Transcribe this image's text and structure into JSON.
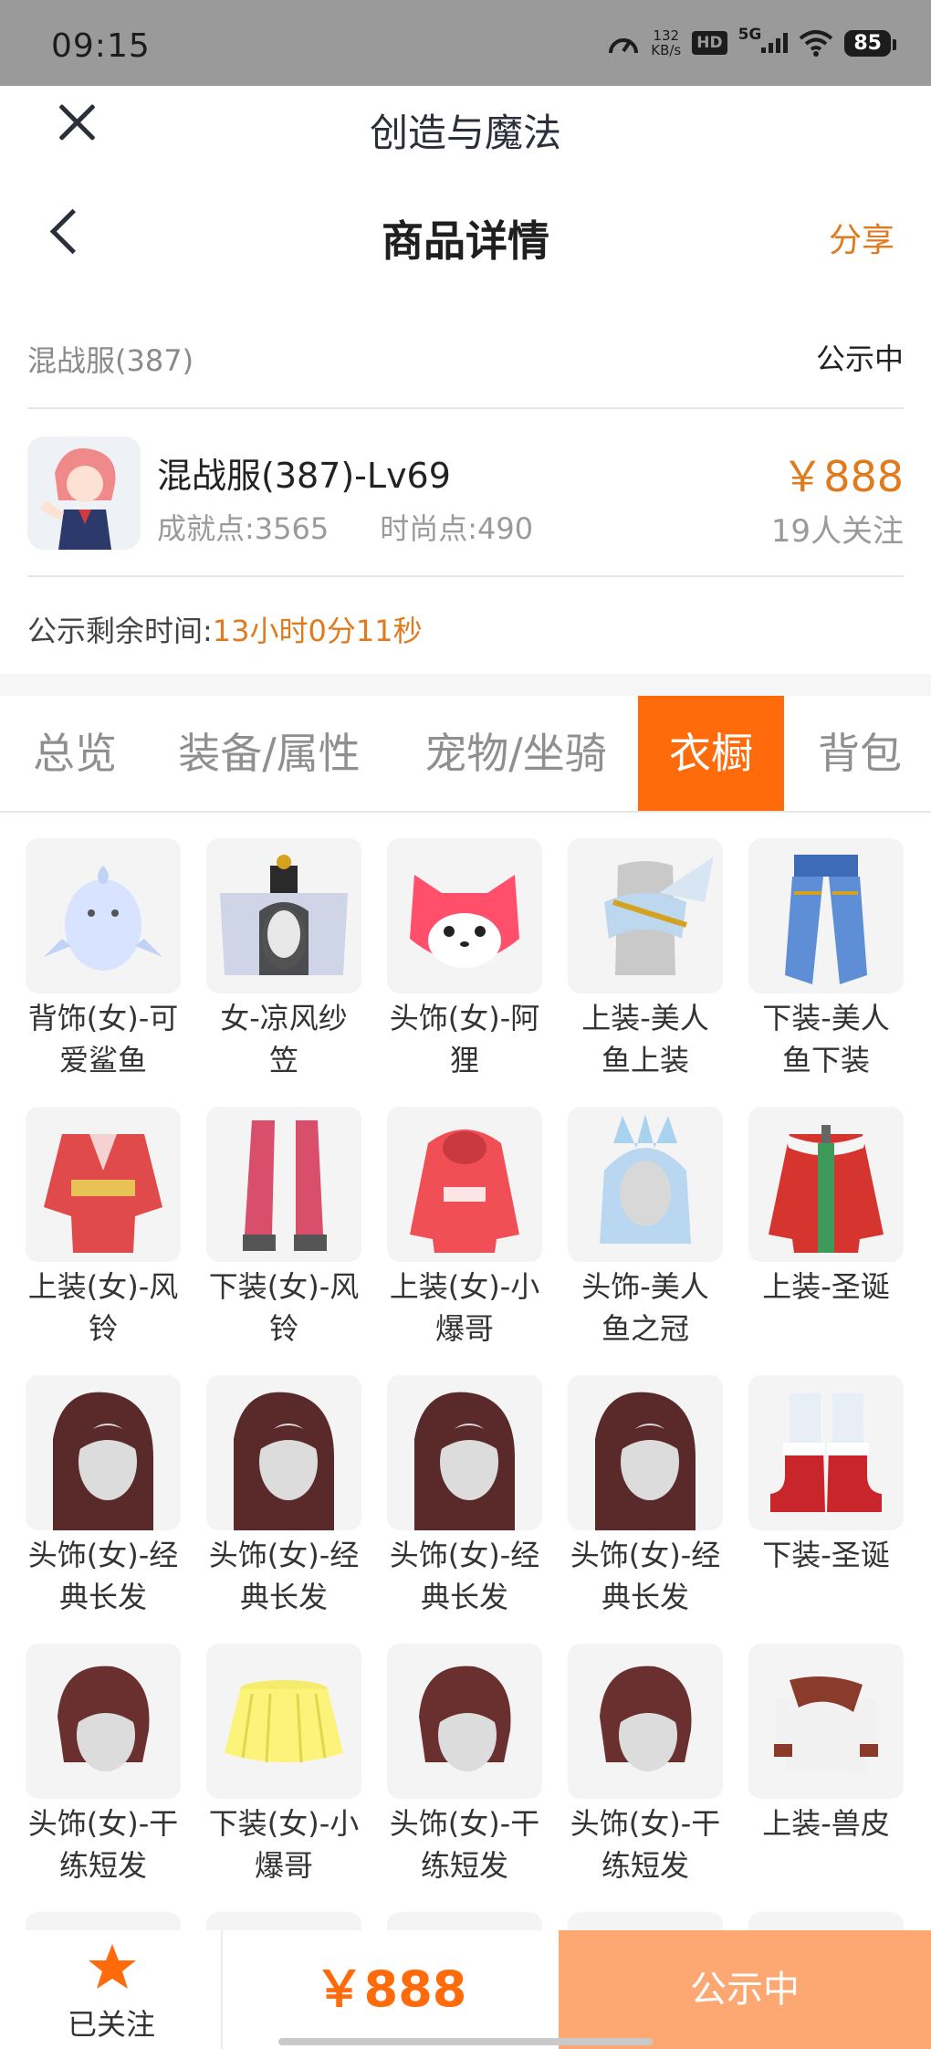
{
  "status_bar": {
    "time": "09:15",
    "speed": "132",
    "speed_unit": "KB/s",
    "hd": "HD",
    "network": "5G",
    "battery": "85"
  },
  "app": {
    "title": "创造与魔法"
  },
  "header": {
    "title": "商品详情",
    "share": "分享"
  },
  "server": {
    "name": "混战服(387)",
    "status": "公示中"
  },
  "item": {
    "title": "混战服(387)-Lv69",
    "achievement": "成就点:3565",
    "fashion": "时尚点:490",
    "price": "￥888",
    "followers": "19人关注"
  },
  "countdown": {
    "label": "公示剩余时间:",
    "value": "13小时0分11秒"
  },
  "tabs": [
    {
      "label": "总览"
    },
    {
      "label": "装备/属性"
    },
    {
      "label": "宠物/坐骑"
    },
    {
      "label": "衣橱",
      "active": true
    },
    {
      "label": "背包"
    }
  ],
  "wardrobe": [
    {
      "label": "背饰(女)-可爱鲨鱼",
      "icon": "shark-backpack-icon"
    },
    {
      "label": "女-凉风纱笠",
      "icon": "veil-hat-icon"
    },
    {
      "label": "头饰(女)-阿狸",
      "icon": "fox-head-icon"
    },
    {
      "label": "上装-美人鱼上装",
      "icon": "mermaid-top-icon"
    },
    {
      "label": "下装-美人鱼下装",
      "icon": "mermaid-bottom-icon"
    },
    {
      "label": "上装(女)-风铃",
      "icon": "kimono-top-icon"
    },
    {
      "label": "下装(女)-风铃",
      "icon": "boots-icon"
    },
    {
      "label": "上装(女)-小爆哥",
      "icon": "hoodie-icon"
    },
    {
      "label": "头饰-美人鱼之冠",
      "icon": "crown-hair-icon"
    },
    {
      "label": "上装-圣诞",
      "icon": "christmas-coat-icon"
    },
    {
      "label": "头饰(女)-经典长发",
      "icon": "long-hair-icon"
    },
    {
      "label": "头饰(女)-经典长发",
      "icon": "long-hair-icon"
    },
    {
      "label": "头饰(女)-经典长发",
      "icon": "long-hair-icon"
    },
    {
      "label": "头饰(女)-经典长发",
      "icon": "long-hair-icon"
    },
    {
      "label": "下装-圣诞",
      "icon": "christmas-boots-icon"
    },
    {
      "label": "头饰(女)-干练短发",
      "icon": "short-hair-icon"
    },
    {
      "label": "下装(女)-小爆哥",
      "icon": "yellow-skirt-icon"
    },
    {
      "label": "头饰(女)-干练短发",
      "icon": "short-hair-icon"
    },
    {
      "label": "头饰(女)-干练短发",
      "icon": "short-hair-icon"
    },
    {
      "label": "上装-兽皮",
      "icon": "fur-top-icon"
    }
  ],
  "bottom": {
    "follow": "已关注",
    "price": "￥888",
    "status": "公示中"
  },
  "colors": {
    "accent": "#ff6a0a",
    "price": "#e07a1e",
    "status_button": "#fda873"
  }
}
